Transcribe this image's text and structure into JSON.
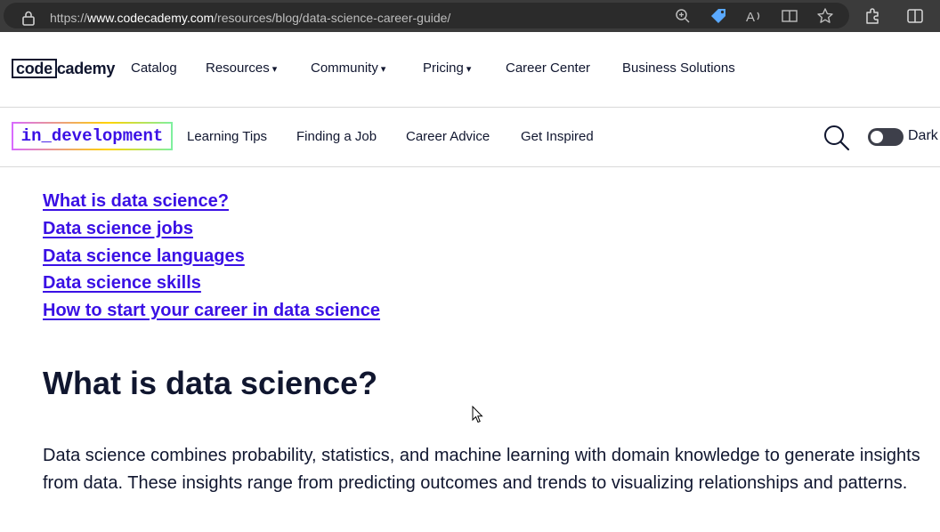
{
  "browser": {
    "url_prefix": "https://",
    "url_host": "www.codecademy.com",
    "url_path": "/resources/blog/data-science-career-guide/",
    "icons": [
      "lock-icon",
      "zoom-icon",
      "coupon-tag-icon",
      "read-aloud-icon",
      "immersive-reader-icon",
      "favorite-star-icon",
      "extensions-icon",
      "split-screen-icon"
    ]
  },
  "site_nav": {
    "logo_box": "code",
    "logo_rest": "cademy",
    "items": [
      {
        "label": "Catalog"
      },
      {
        "label": "Resources",
        "caret": "▾"
      },
      {
        "label": "Community",
        "caret": "▾"
      },
      {
        "label": "Pricing",
        "caret": "▾"
      },
      {
        "label": "Career Center"
      },
      {
        "label": "Business Solutions"
      }
    ]
  },
  "blog_nav": {
    "logo": "in_development",
    "items": [
      "Learning Tips",
      "Finding a Job",
      "Career Advice",
      "Get Inspired"
    ],
    "toggle_label": "Dark"
  },
  "article": {
    "toc": [
      "What is data science?",
      "Data science jobs",
      "Data science languages",
      "Data science skills",
      "How to start your career in data science"
    ],
    "heading": "What is data science?",
    "paragraph": "Data science combines probability, statistics, and machine learning with domain knowledge to generate insights from data. These insights range from predicting outcomes and trends to visualizing relationships and patterns."
  },
  "colors": {
    "link": "#3a10e5",
    "text": "#10162f",
    "browser_bar": "#3b3b3b"
  }
}
